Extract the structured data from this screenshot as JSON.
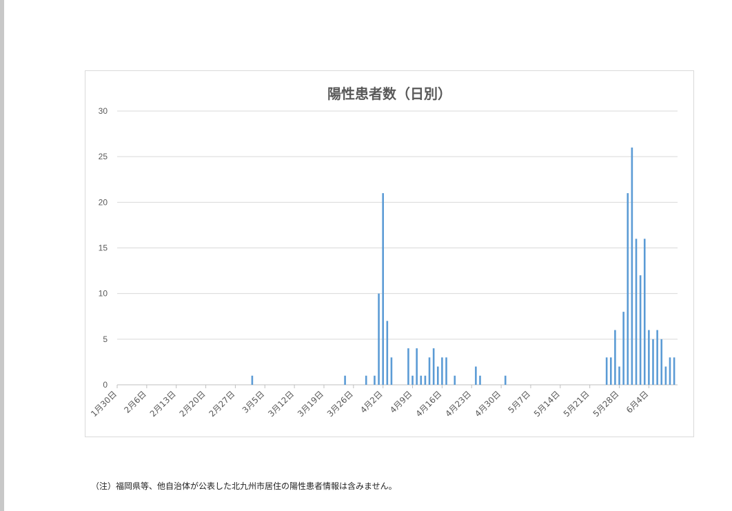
{
  "chart_data": {
    "type": "bar",
    "title": "陽性患者数（日別）",
    "xlabel": "",
    "ylabel": "",
    "ylim": [
      0,
      30
    ],
    "yticks": [
      0,
      5,
      10,
      15,
      20,
      25,
      30
    ],
    "grid": true,
    "legend": "none",
    "x_tick_labels": [
      "1月30日",
      "2月6日",
      "2月13日",
      "2月20日",
      "2月27日",
      "3月5日",
      "3月12日",
      "3月19日",
      "3月26日",
      "4月2日",
      "4月9日",
      "4月16日",
      "4月23日",
      "4月30日",
      "5月7日",
      "5月14日",
      "5月21日",
      "5月28日",
      "6月4日"
    ],
    "first_date": "1月30日",
    "last_date": "6月7日",
    "bars": [
      {
        "date": "3月2日",
        "value": 1
      },
      {
        "date": "3月24日",
        "value": 1
      },
      {
        "date": "3月29日",
        "value": 1
      },
      {
        "date": "3月31日",
        "value": 1
      },
      {
        "date": "4月1日",
        "value": 10
      },
      {
        "date": "4月2日",
        "value": 21
      },
      {
        "date": "4月3日",
        "value": 7
      },
      {
        "date": "4月4日",
        "value": 3
      },
      {
        "date": "4月8日",
        "value": 4
      },
      {
        "date": "4月9日",
        "value": 1
      },
      {
        "date": "4月10日",
        "value": 4
      },
      {
        "date": "4月11日",
        "value": 1
      },
      {
        "date": "4月12日",
        "value": 1
      },
      {
        "date": "4月13日",
        "value": 3
      },
      {
        "date": "4月14日",
        "value": 4
      },
      {
        "date": "4月15日",
        "value": 2
      },
      {
        "date": "4月16日",
        "value": 3
      },
      {
        "date": "4月17日",
        "value": 3
      },
      {
        "date": "4月19日",
        "value": 1
      },
      {
        "date": "4月24日",
        "value": 2
      },
      {
        "date": "4月25日",
        "value": 1
      },
      {
        "date": "5月1日",
        "value": 1
      },
      {
        "date": "5月25日",
        "value": 3
      },
      {
        "date": "5月26日",
        "value": 3
      },
      {
        "date": "5月27日",
        "value": 6
      },
      {
        "date": "5月28日",
        "value": 2
      },
      {
        "date": "5月29日",
        "value": 8
      },
      {
        "date": "5月30日",
        "value": 21
      },
      {
        "date": "5月31日",
        "value": 26
      },
      {
        "date": "6月1日",
        "value": 16
      },
      {
        "date": "6月2日",
        "value": 12
      },
      {
        "date": "6月3日",
        "value": 16
      },
      {
        "date": "6月4日",
        "value": 6
      },
      {
        "date": "6月5日",
        "value": 5
      },
      {
        "date": "6月6日",
        "value": 6
      },
      {
        "date": "6月7日",
        "value": 5
      },
      {
        "date": "6月8日",
        "value": 2
      },
      {
        "date": "6月9日",
        "value": 3
      },
      {
        "date": "6月10日",
        "value": 3
      }
    ],
    "bar_color": "#5b9bd5"
  },
  "note": "（注）福岡県等、他自治体が公表した北九州市居住の陽性患者情報は含みません。"
}
